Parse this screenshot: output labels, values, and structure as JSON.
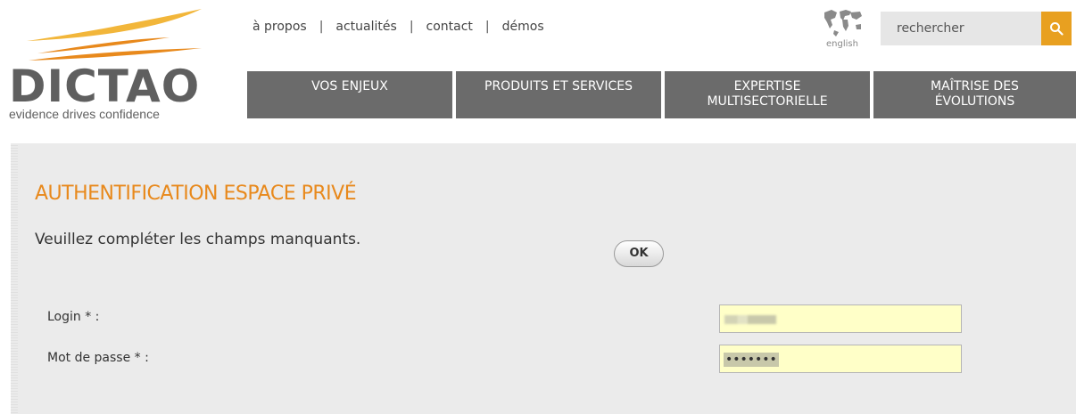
{
  "brand": {
    "logo_text": "DICTAO",
    "tagline": "evidence drives confidence"
  },
  "top_links": [
    {
      "label": "à propos"
    },
    {
      "label": "actualités"
    },
    {
      "label": "contact"
    },
    {
      "label": "démos"
    }
  ],
  "language": {
    "label": "english"
  },
  "search": {
    "placeholder": "rechercher"
  },
  "main_nav": [
    {
      "line1": "VOS ENJEUX",
      "line2": ""
    },
    {
      "line1": "PRODUITS ET SERVICES",
      "line2": ""
    },
    {
      "line1": "EXPERTISE",
      "line2": "MULTISECTORIELLE"
    },
    {
      "line1": "MAÎTRISE DES",
      "line2": "ÉVOLUTIONS"
    }
  ],
  "auth": {
    "title": "AUTHENTIFICATION ESPACE PRIVÉ",
    "subtitle": "Veuillez compléter les champs manquants.",
    "login_label": "Login * :",
    "password_label": "Mot de passe * :",
    "password_mask": "•••••••",
    "ok_label": "OK"
  },
  "colors": {
    "accent": "#e8891c",
    "nav_bg": "#6b6b6b",
    "input_bg": "#ffffc8",
    "search_btn": "#e8a020"
  }
}
